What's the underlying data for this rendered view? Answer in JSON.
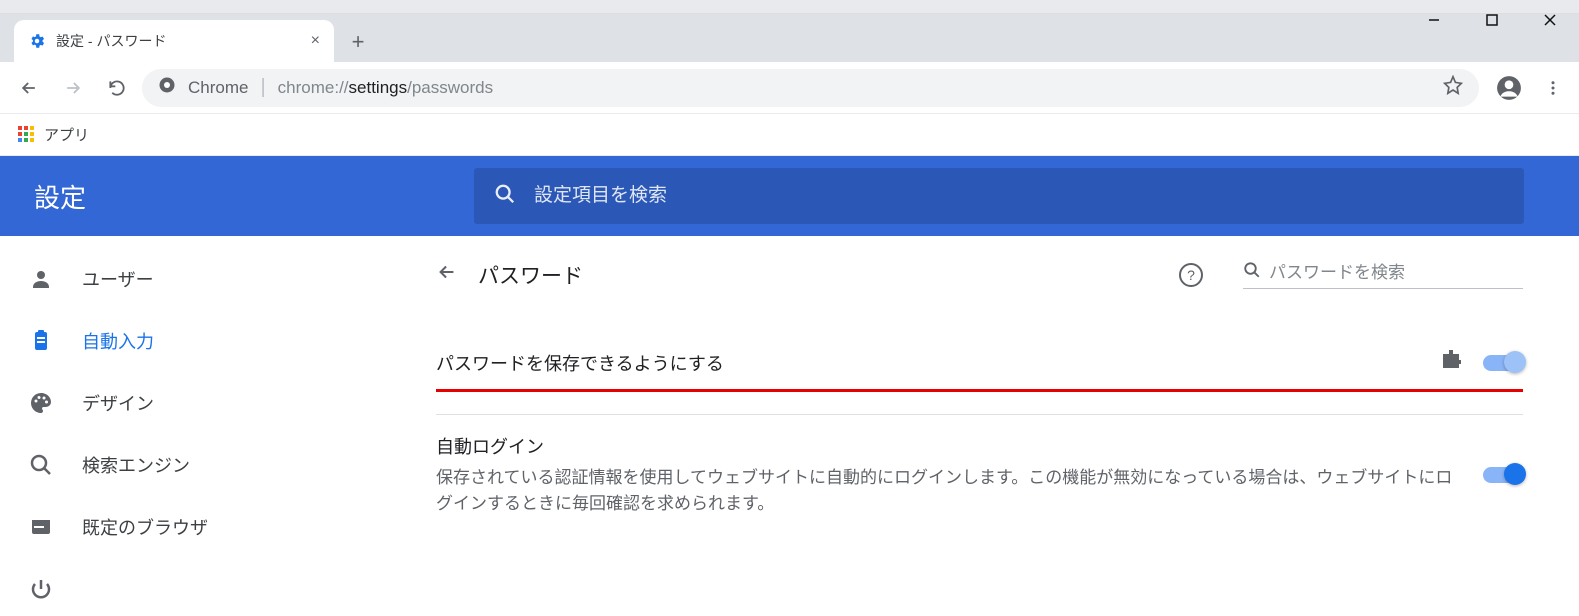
{
  "tab": {
    "title": "設定 - パスワード"
  },
  "address": {
    "label": "Chrome",
    "url_prefix": "chrome://",
    "url_bold": "settings",
    "url_rest": "/passwords"
  },
  "bookmarks": {
    "apps": "アプリ"
  },
  "header": {
    "title": "設定",
    "search_placeholder": "設定項目を検索"
  },
  "sidebar": {
    "items": [
      {
        "label": "ユーザー"
      },
      {
        "label": "自動入力"
      },
      {
        "label": "デザイン"
      },
      {
        "label": "検索エンジン"
      },
      {
        "label": "既定のブラウザ"
      }
    ]
  },
  "page": {
    "title": "パスワード",
    "search_placeholder": "パスワードを検索",
    "setting1": {
      "title": "パスワードを保存できるようにする"
    },
    "setting2": {
      "title": "自動ログイン",
      "desc": "保存されている認証情報を使用してウェブサイトに自動的にログインします。この機能が無効になっている場合は、ウェブサイトにログインするときに毎回確認を求められます。"
    }
  }
}
